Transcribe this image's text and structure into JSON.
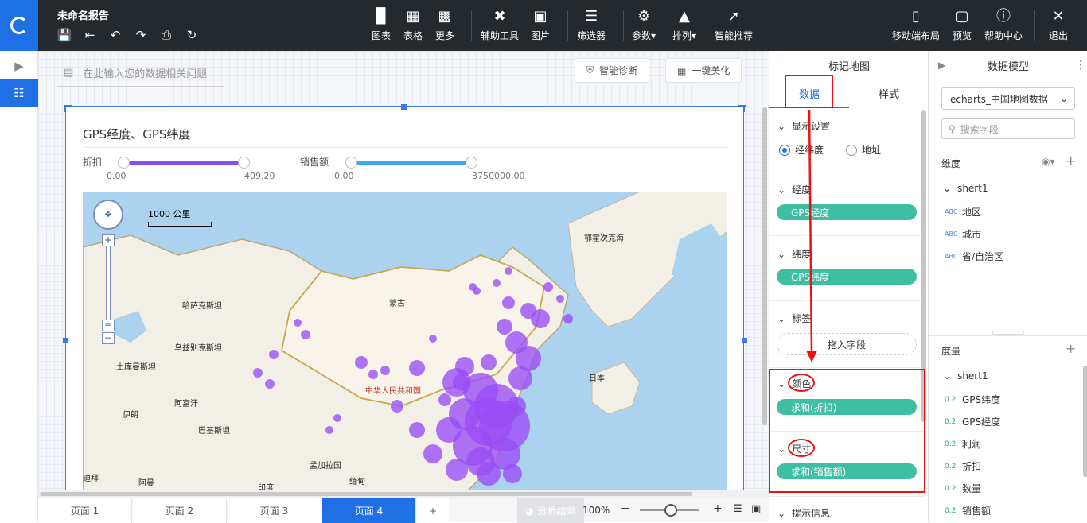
{
  "app": {
    "report_title": "未命名报告"
  },
  "toolbar": {
    "chart": "图表",
    "table": "表格",
    "more": "更多",
    "assist": "辅助工具",
    "image": "图片",
    "filter": "筛选器",
    "params": "参数",
    "arrange": "排列",
    "smart": "智能推荐",
    "mobile": "移动端布局",
    "preview": "预览",
    "help": "帮助中心",
    "exit": "退出"
  },
  "canvas": {
    "question_placeholder": "在此输入您的数据相关问题",
    "diagnose": "智能诊断",
    "beautify": "一键美化"
  },
  "widget": {
    "title": "GPS经度、GPS纬度",
    "slider1": {
      "label": "折扣",
      "min": "0.00",
      "max": "409.20",
      "color": "#8a4af5"
    },
    "slider2": {
      "label": "销售额",
      "min": "0.00",
      "max": "3750000.00",
      "color": "#3aa8f0"
    },
    "map": {
      "scale": "1000 公里",
      "labels": [
        "鄂霍次克海",
        "哈萨克斯坦",
        "蒙古",
        "乌兹别克斯坦",
        "土库曼斯坦",
        "中华人民共和国",
        "日本",
        "伊朗",
        "阿富汗",
        "巴基斯坦",
        "孟加拉国",
        "印度",
        "缅甸",
        "阿曼",
        "迪拜"
      ],
      "bubble_color": "#9a4cf5"
    }
  },
  "pages": [
    "页面 1",
    "页面 2",
    "页面 3",
    "页面 4",
    "+"
  ],
  "bottom": {
    "analysis": "分析结果",
    "zoom": "100%"
  },
  "panel": {
    "title": "标记地图",
    "tab_data": "数据",
    "tab_style": "样式",
    "display_settings": "显示设置",
    "radio_lnglat": "经纬度",
    "radio_address": "地址",
    "lng_label": "经度",
    "lng_field": "GPS经度",
    "lat_label": "纬度",
    "lat_field": "GPS纬度",
    "tag_label": "标签",
    "drop_hint": "拖入字段",
    "color_label": "颜色",
    "color_field": "求和(折扣)",
    "size_label": "尺寸",
    "size_field": "求和(销售额)",
    "tooltip_label": "提示信息"
  },
  "model": {
    "title": "数据模型",
    "dataset": "echarts_中国地图数据",
    "search_placeholder": "搜索字段",
    "dim_label": "维度",
    "dim_group": "shert1",
    "dims": [
      "地区",
      "城市",
      "省/自治区"
    ],
    "dim_type": "ABC",
    "measure_label": "度量",
    "measure_group": "shert1",
    "measures": [
      "GPS纬度",
      "GPS经度",
      "利润",
      "折扣",
      "数量",
      "销售额"
    ],
    "measure_type": "0.2"
  }
}
